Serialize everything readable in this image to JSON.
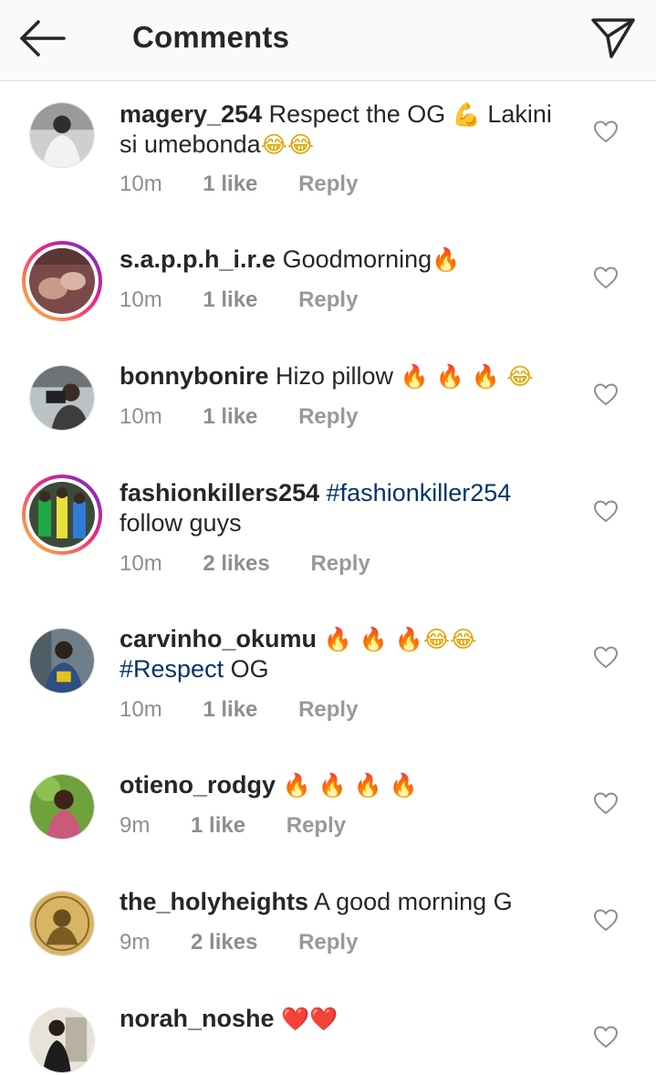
{
  "header": {
    "title": "Comments"
  },
  "comments": [
    {
      "username": "magery_254",
      "pre": "Respect the OG ",
      "e1": "💪",
      "post": " Lakini si umebonda",
      "e2": "😂😂",
      "time": "10m",
      "likes": "1 like",
      "reply": "Reply"
    },
    {
      "username": "s.a.p.p.h_i.r.e",
      "body": "Goodmorning",
      "e1": "🔥",
      "time": "10m",
      "likes": "1 like",
      "reply": "Reply"
    },
    {
      "username": "bonnybonire",
      "body": "Hizo pillow ",
      "e1": "🔥 🔥 🔥",
      "e2": "😂",
      "time": "10m",
      "likes": "1 like",
      "reply": "Reply"
    },
    {
      "username": "fashionkillers254",
      "tag": "#fashionkiller254",
      "body2": "follow guys",
      "time": "10m",
      "likes": "2 likes",
      "reply": "Reply"
    },
    {
      "username": "carvinho_okumu",
      "e1": "🔥 🔥 🔥",
      "e2": "😂😂",
      "tag": "#Respect",
      "body2": " OG",
      "time": "10m",
      "likes": "1 like",
      "reply": "Reply"
    },
    {
      "username": "otieno_rodgy",
      "e1": "🔥 🔥 🔥 🔥",
      "time": "9m",
      "likes": "1 like",
      "reply": "Reply"
    },
    {
      "username": "the_holyheights",
      "body": "A good morning G",
      "time": "9m",
      "likes": "2 likes",
      "reply": "Reply"
    },
    {
      "username": "norah_noshe",
      "e1": "❤️❤️"
    }
  ]
}
